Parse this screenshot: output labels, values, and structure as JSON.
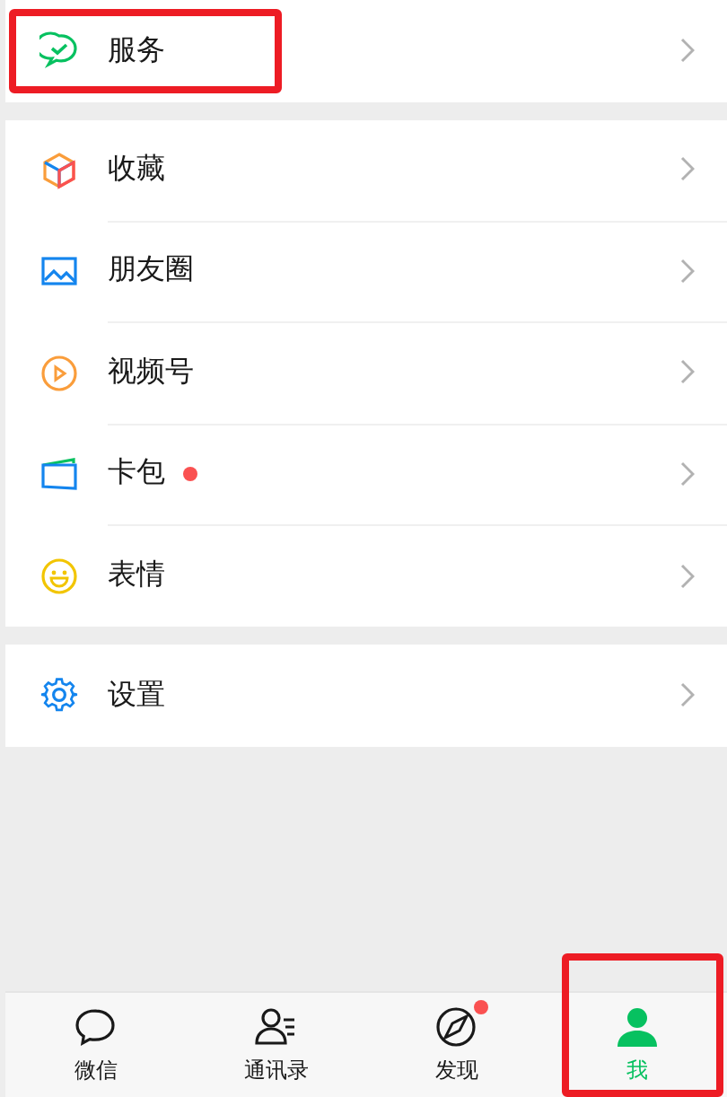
{
  "groups": [
    {
      "items": [
        {
          "label": "服务",
          "dot": false,
          "highlighted": true
        }
      ]
    },
    {
      "items": [
        {
          "label": "收藏",
          "dot": false,
          "highlighted": false
        },
        {
          "label": "朋友圈",
          "dot": false,
          "highlighted": false
        },
        {
          "label": "视频号",
          "dot": false,
          "highlighted": false
        },
        {
          "label": "卡包",
          "dot": true,
          "highlighted": false
        },
        {
          "label": "表情",
          "dot": false,
          "highlighted": false
        }
      ]
    },
    {
      "items": [
        {
          "label": "设置",
          "dot": false,
          "highlighted": false
        }
      ]
    }
  ],
  "tabs": [
    {
      "label": "微信",
      "selected": false,
      "dot": false,
      "highlighted": false
    },
    {
      "label": "通讯录",
      "selected": false,
      "dot": false,
      "highlighted": false
    },
    {
      "label": "发现",
      "selected": false,
      "dot": true,
      "highlighted": false
    },
    {
      "label": "我",
      "selected": true,
      "dot": false,
      "highlighted": true
    }
  ]
}
